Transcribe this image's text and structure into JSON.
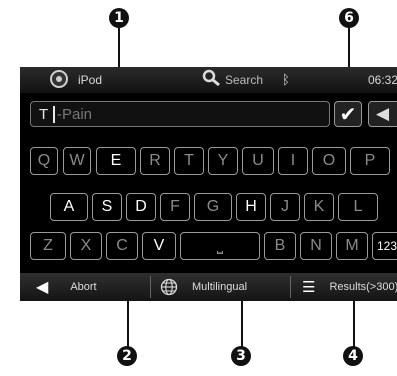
{
  "callouts": [
    "1",
    "2",
    "3",
    "4",
    "6"
  ],
  "status_bar": {
    "app_label": "iPod",
    "search_label": "Search",
    "clock": "06:32",
    "bluetooth_icon": "bluetooth-icon"
  },
  "input": {
    "typed_text": "T",
    "hint_text": "-Pain"
  },
  "keyboard": {
    "row1": [
      "Q",
      "W",
      "E",
      "R",
      "T",
      "Y",
      "U",
      "I",
      "O",
      "P"
    ],
    "row2": [
      "A",
      "S",
      "D",
      "F",
      "G",
      "H",
      "J",
      "K",
      "L"
    ],
    "row3": [
      "Z",
      "X",
      "C",
      "V",
      "⎵",
      "B",
      "N",
      "M",
      "123"
    ],
    "highlighted_keys": [
      "E",
      "A",
      "S",
      "D",
      "H",
      "V",
      "123"
    ]
  },
  "bottom_bar": {
    "abort_label": "Abort",
    "multilingual_label": "Multilingual",
    "results_label": "Results(>300)"
  }
}
